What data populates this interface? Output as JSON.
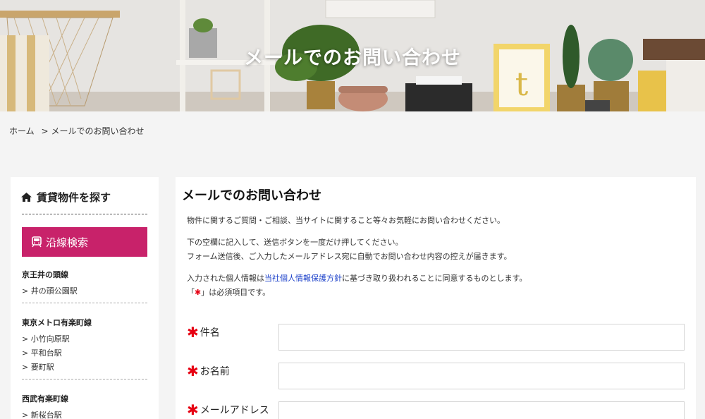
{
  "hero": {
    "title": "メールでのお問い合わせ"
  },
  "breadcrumb": {
    "home": "ホーム",
    "separator": ">",
    "current": "メールでのお問い合わせ"
  },
  "sidebar": {
    "heading": "賃貸物件を探す",
    "line_search_button": "沿線検索",
    "groups": [
      {
        "name": "京王井の頭線",
        "stations": [
          "> 井の頭公園駅"
        ]
      },
      {
        "name": "東京メトロ有楽町線",
        "stations": [
          "> 小竹向原駅",
          "> 平和台駅",
          "> 要町駅"
        ]
      },
      {
        "name": "西武有楽町線",
        "stations": [
          "> 新桜台駅"
        ]
      }
    ]
  },
  "main": {
    "heading": "メールでのお問い合わせ",
    "p1": "物件に関するご質問・ご相談、当サイトに関すること等々お気軽にお問い合わせください。",
    "p2_line1": "下の空欄に記入して、送信ボタンを一度だけ押してください。",
    "p2_line2": "フォーム送信後、ご入力したメールアドレス宛に自動でお問い合わせ内容の控えが届きます。",
    "p3_pre": "入力された個人情報は",
    "p3_link": "当社個人情報保護方針",
    "p3_post": "に基づき取り扱われることに同意するものとします。",
    "p4_open": "「",
    "p4_mark": "✱",
    "p4_close": "」は必須項目です。",
    "fields": [
      {
        "label": "件名",
        "value": ""
      },
      {
        "label": "お名前",
        "value": ""
      },
      {
        "label": "メールアドレス",
        "value": ""
      }
    ],
    "required_mark": "✱"
  },
  "colors": {
    "accent": "#c8226a",
    "link": "#1a3fc9",
    "required": "#e60012"
  }
}
